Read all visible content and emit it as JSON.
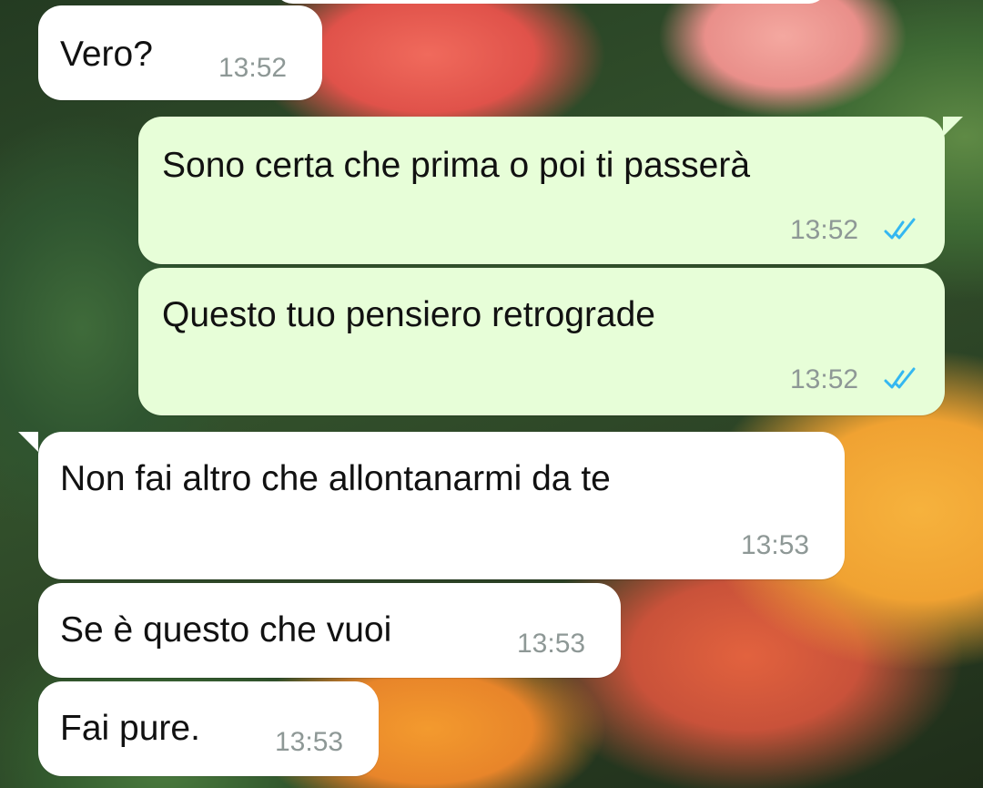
{
  "messages": [
    {
      "text": "Vero?",
      "time": "13:52",
      "direction": "in"
    },
    {
      "text": "Sono certa che prima o poi ti passerà",
      "time": "13:52",
      "direction": "out",
      "status": "read"
    },
    {
      "text": "Questo tuo pensiero retrograde",
      "time": "13:52",
      "direction": "out",
      "status": "read"
    },
    {
      "text": "Non fai altro che allontanarmi da te",
      "time": "13:53",
      "direction": "in"
    },
    {
      "text": "Se è questo che vuoi",
      "time": "13:53",
      "direction": "in"
    },
    {
      "text": "Fai pure.",
      "time": "13:53",
      "direction": "in"
    }
  ],
  "colors": {
    "incoming_bubble": "#ffffff",
    "outgoing_bubble": "#e7fed8",
    "read_ticks": "#34b7f1",
    "timestamp": "#8e9896"
  },
  "icons": {
    "read_receipt": "double-check-icon"
  }
}
